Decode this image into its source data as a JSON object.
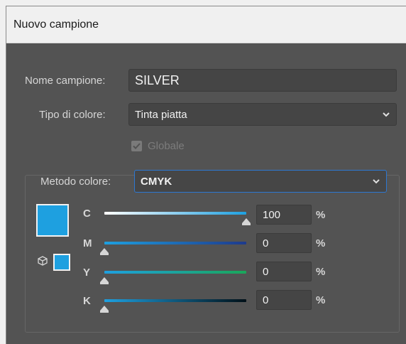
{
  "dialog": {
    "title": "Nuovo campione",
    "swatch_name_label": "Nome campione:",
    "swatch_name_value": "SILVER",
    "color_type_label": "Tipo di colore:",
    "color_type_value": "Tinta piatta",
    "global_label": "Globale",
    "global_checked": true,
    "global_enabled": false,
    "color_mode_label": "Metodo colore:",
    "color_mode_value": "CMYK",
    "swatch_color": "#1ea0e0",
    "channels": [
      {
        "letter": "C",
        "value": "100",
        "unit": "%",
        "level": 1.0,
        "gradient_start": "#ffffff",
        "gradient_end": "#1ea0e0"
      },
      {
        "letter": "M",
        "value": "0",
        "unit": "%",
        "level": 0.0,
        "gradient_start": "#1ea0e0",
        "gradient_end": "#1e3a8c"
      },
      {
        "letter": "Y",
        "value": "0",
        "unit": "%",
        "level": 0.0,
        "gradient_start": "#1ea0e0",
        "gradient_end": "#1aa65a"
      },
      {
        "letter": "K",
        "value": "0",
        "unit": "%",
        "level": 0.0,
        "gradient_start": "#1ea0e0",
        "gradient_end": "#001018"
      }
    ]
  }
}
